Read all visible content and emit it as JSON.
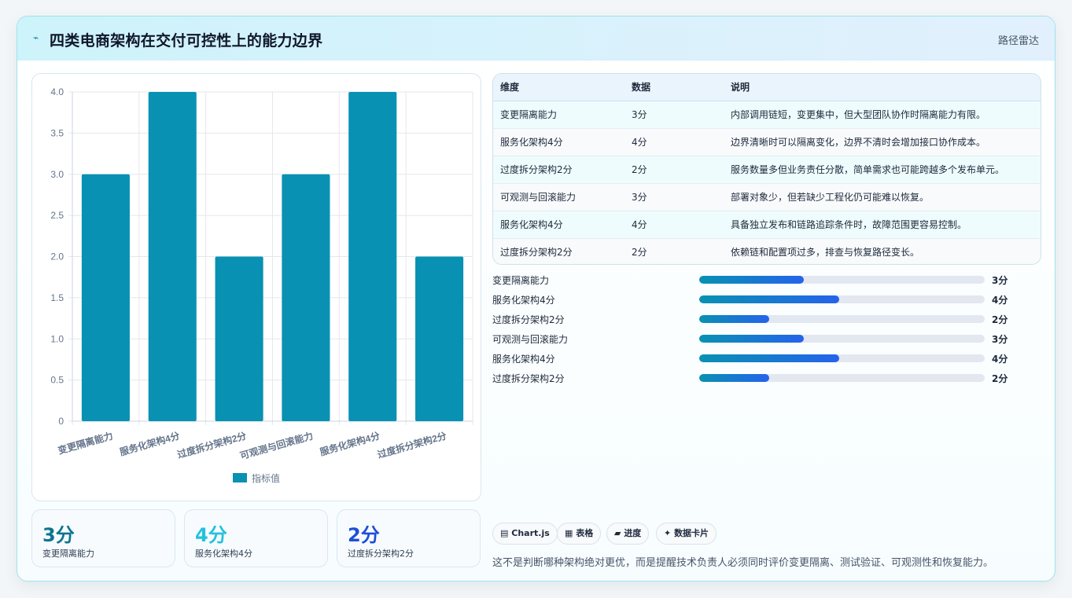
{
  "header": {
    "icon": "trend-icon",
    "title": "四类电商架构在交付可控性上的能力边界",
    "right_label": "路径雷达"
  },
  "chart_data": {
    "type": "bar",
    "categories": [
      "变更隔离能力",
      "服务化架构4分",
      "过度拆分架构2分",
      "可观测与回滚能力",
      "服务化架构4分",
      "过度拆分架构2分"
    ],
    "series": [
      {
        "name": "指标值",
        "values": [
          3,
          4,
          2,
          3,
          4,
          2
        ],
        "color": "#0891b2"
      }
    ],
    "yticks": [
      "0",
      "0.5",
      "1.0",
      "1.5",
      "2.0",
      "2.5",
      "3.0",
      "3.5",
      "4.0"
    ],
    "ylim": [
      0,
      4
    ],
    "grid": true,
    "legend_position": "bottom"
  },
  "stats": [
    {
      "value": "3分",
      "label": "变更隔离能力",
      "color": "#0e7490"
    },
    {
      "value": "4分",
      "label": "服务化架构4分",
      "color": "#22c1dc"
    },
    {
      "value": "2分",
      "label": "过度拆分架构2分",
      "color": "#1d4ed8"
    }
  ],
  "table": {
    "headers": [
      "维度",
      "数据",
      "说明"
    ],
    "rows": [
      [
        "变更隔离能力",
        "3分",
        "内部调用链短，变更集中，但大型团队协作时隔离能力有限。"
      ],
      [
        "服务化架构4分",
        "4分",
        "边界清晰时可以隔离变化，边界不清时会增加接口协作成本。"
      ],
      [
        "过度拆分架构2分",
        "2分",
        "服务数量多但业务责任分散，简单需求也可能跨越多个发布单元。"
      ],
      [
        "可观测与回滚能力",
        "3分",
        "部署对象少，但若缺少工程化仍可能难以恢复。"
      ],
      [
        "服务化架构4分",
        "4分",
        "具备独立发布和链路追踪条件时，故障范围更容易控制。"
      ],
      [
        "过度拆分架构2分",
        "2分",
        "依赖链和配置项过多，排查与恢复路径变长。"
      ]
    ]
  },
  "progress": [
    {
      "label": "变更隔离能力",
      "value": "3分",
      "fraction": 0.367
    },
    {
      "label": "服务化架构4分",
      "value": "4分",
      "fraction": 0.49
    },
    {
      "label": "过度拆分架构2分",
      "value": "2分",
      "fraction": 0.245
    },
    {
      "label": "可观测与回滚能力",
      "value": "3分",
      "fraction": 0.367
    },
    {
      "label": "服务化架构4分",
      "value": "4分",
      "fraction": 0.49
    },
    {
      "label": "过度拆分架构2分",
      "value": "2分",
      "fraction": 0.245
    }
  ],
  "tags": [
    {
      "icon": "chart-icon",
      "glyph": "▤",
      "label": "Chart.js"
    },
    {
      "icon": "table-icon",
      "glyph": "▦",
      "label": "表格"
    },
    {
      "icon": "progress-icon",
      "glyph": "▰",
      "label": "进度"
    },
    {
      "icon": "card-icon",
      "glyph": "✦",
      "label": "数据卡片"
    }
  ],
  "footnote": "这不是判断哪种架构绝对更优，而是提醒技术负责人必须同时评价变更隔离、测试验证、可观测性和恢复能力。"
}
